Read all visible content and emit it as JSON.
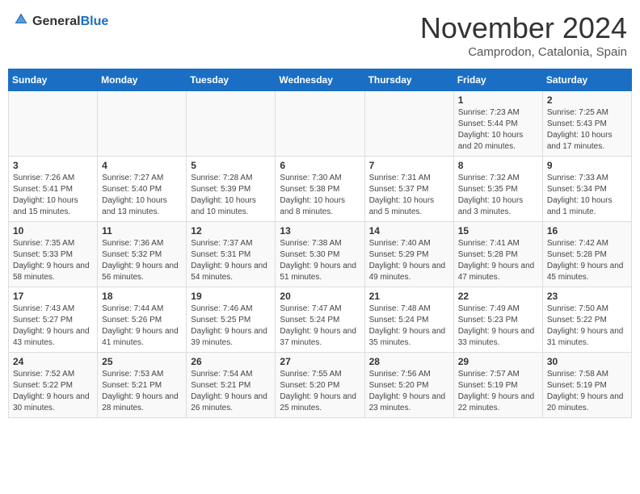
{
  "header": {
    "logo_general": "General",
    "logo_blue": "Blue",
    "month": "November 2024",
    "location": "Camprodon, Catalonia, Spain"
  },
  "weekdays": [
    "Sunday",
    "Monday",
    "Tuesday",
    "Wednesday",
    "Thursday",
    "Friday",
    "Saturday"
  ],
  "weeks": [
    [
      {
        "day": "",
        "info": ""
      },
      {
        "day": "",
        "info": ""
      },
      {
        "day": "",
        "info": ""
      },
      {
        "day": "",
        "info": ""
      },
      {
        "day": "",
        "info": ""
      },
      {
        "day": "1",
        "info": "Sunrise: 7:23 AM\nSunset: 5:44 PM\nDaylight: 10 hours and 20 minutes."
      },
      {
        "day": "2",
        "info": "Sunrise: 7:25 AM\nSunset: 5:43 PM\nDaylight: 10 hours and 17 minutes."
      }
    ],
    [
      {
        "day": "3",
        "info": "Sunrise: 7:26 AM\nSunset: 5:41 PM\nDaylight: 10 hours and 15 minutes."
      },
      {
        "day": "4",
        "info": "Sunrise: 7:27 AM\nSunset: 5:40 PM\nDaylight: 10 hours and 13 minutes."
      },
      {
        "day": "5",
        "info": "Sunrise: 7:28 AM\nSunset: 5:39 PM\nDaylight: 10 hours and 10 minutes."
      },
      {
        "day": "6",
        "info": "Sunrise: 7:30 AM\nSunset: 5:38 PM\nDaylight: 10 hours and 8 minutes."
      },
      {
        "day": "7",
        "info": "Sunrise: 7:31 AM\nSunset: 5:37 PM\nDaylight: 10 hours and 5 minutes."
      },
      {
        "day": "8",
        "info": "Sunrise: 7:32 AM\nSunset: 5:35 PM\nDaylight: 10 hours and 3 minutes."
      },
      {
        "day": "9",
        "info": "Sunrise: 7:33 AM\nSunset: 5:34 PM\nDaylight: 10 hours and 1 minute."
      }
    ],
    [
      {
        "day": "10",
        "info": "Sunrise: 7:35 AM\nSunset: 5:33 PM\nDaylight: 9 hours and 58 minutes."
      },
      {
        "day": "11",
        "info": "Sunrise: 7:36 AM\nSunset: 5:32 PM\nDaylight: 9 hours and 56 minutes."
      },
      {
        "day": "12",
        "info": "Sunrise: 7:37 AM\nSunset: 5:31 PM\nDaylight: 9 hours and 54 minutes."
      },
      {
        "day": "13",
        "info": "Sunrise: 7:38 AM\nSunset: 5:30 PM\nDaylight: 9 hours and 51 minutes."
      },
      {
        "day": "14",
        "info": "Sunrise: 7:40 AM\nSunset: 5:29 PM\nDaylight: 9 hours and 49 minutes."
      },
      {
        "day": "15",
        "info": "Sunrise: 7:41 AM\nSunset: 5:28 PM\nDaylight: 9 hours and 47 minutes."
      },
      {
        "day": "16",
        "info": "Sunrise: 7:42 AM\nSunset: 5:28 PM\nDaylight: 9 hours and 45 minutes."
      }
    ],
    [
      {
        "day": "17",
        "info": "Sunrise: 7:43 AM\nSunset: 5:27 PM\nDaylight: 9 hours and 43 minutes."
      },
      {
        "day": "18",
        "info": "Sunrise: 7:44 AM\nSunset: 5:26 PM\nDaylight: 9 hours and 41 minutes."
      },
      {
        "day": "19",
        "info": "Sunrise: 7:46 AM\nSunset: 5:25 PM\nDaylight: 9 hours and 39 minutes."
      },
      {
        "day": "20",
        "info": "Sunrise: 7:47 AM\nSunset: 5:24 PM\nDaylight: 9 hours and 37 minutes."
      },
      {
        "day": "21",
        "info": "Sunrise: 7:48 AM\nSunset: 5:24 PM\nDaylight: 9 hours and 35 minutes."
      },
      {
        "day": "22",
        "info": "Sunrise: 7:49 AM\nSunset: 5:23 PM\nDaylight: 9 hours and 33 minutes."
      },
      {
        "day": "23",
        "info": "Sunrise: 7:50 AM\nSunset: 5:22 PM\nDaylight: 9 hours and 31 minutes."
      }
    ],
    [
      {
        "day": "24",
        "info": "Sunrise: 7:52 AM\nSunset: 5:22 PM\nDaylight: 9 hours and 30 minutes."
      },
      {
        "day": "25",
        "info": "Sunrise: 7:53 AM\nSunset: 5:21 PM\nDaylight: 9 hours and 28 minutes."
      },
      {
        "day": "26",
        "info": "Sunrise: 7:54 AM\nSunset: 5:21 PM\nDaylight: 9 hours and 26 minutes."
      },
      {
        "day": "27",
        "info": "Sunrise: 7:55 AM\nSunset: 5:20 PM\nDaylight: 9 hours and 25 minutes."
      },
      {
        "day": "28",
        "info": "Sunrise: 7:56 AM\nSunset: 5:20 PM\nDaylight: 9 hours and 23 minutes."
      },
      {
        "day": "29",
        "info": "Sunrise: 7:57 AM\nSunset: 5:19 PM\nDaylight: 9 hours and 22 minutes."
      },
      {
        "day": "30",
        "info": "Sunrise: 7:58 AM\nSunset: 5:19 PM\nDaylight: 9 hours and 20 minutes."
      }
    ]
  ]
}
